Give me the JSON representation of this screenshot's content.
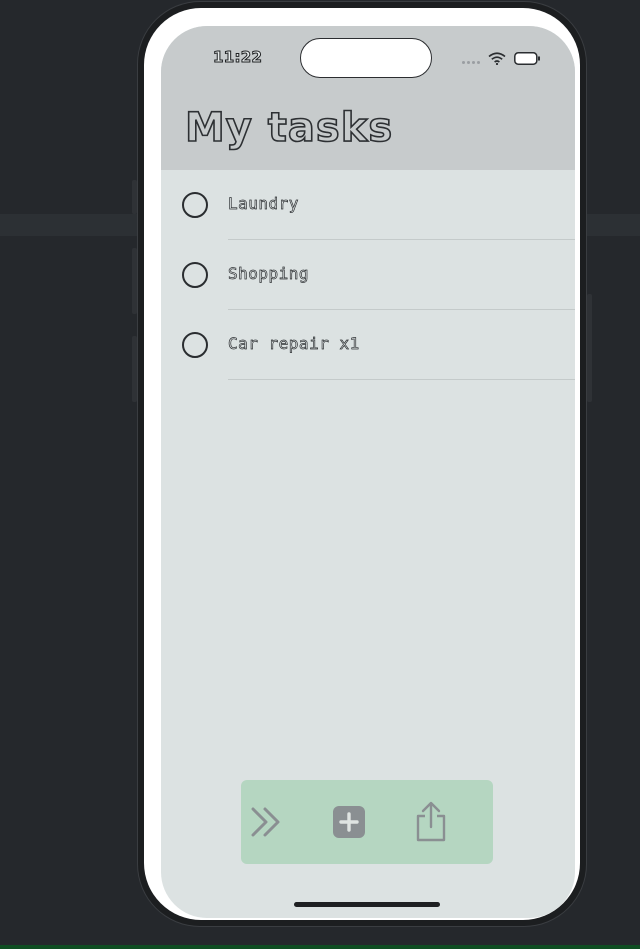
{
  "status_bar": {
    "time": "11:22",
    "icons": [
      "cellular-dots-icon",
      "wifi-icon",
      "battery-icon"
    ]
  },
  "header": {
    "title": "My tasks"
  },
  "tasks": [
    {
      "label": "Laundry",
      "done": false
    },
    {
      "label": "Shopping",
      "done": false
    },
    {
      "label": "Car repair x1",
      "done": false
    }
  ],
  "toolbar": {
    "buttons": [
      "chevrons-right-icon",
      "plus-square-icon",
      "share-icon"
    ]
  },
  "colors": {
    "page_background": "#25282c",
    "header_background": "#c7cbcc",
    "screen_background": "#dce2e2",
    "toolbar_background": "#b5d6c1",
    "toolbar_icon": "#8a8f92"
  }
}
